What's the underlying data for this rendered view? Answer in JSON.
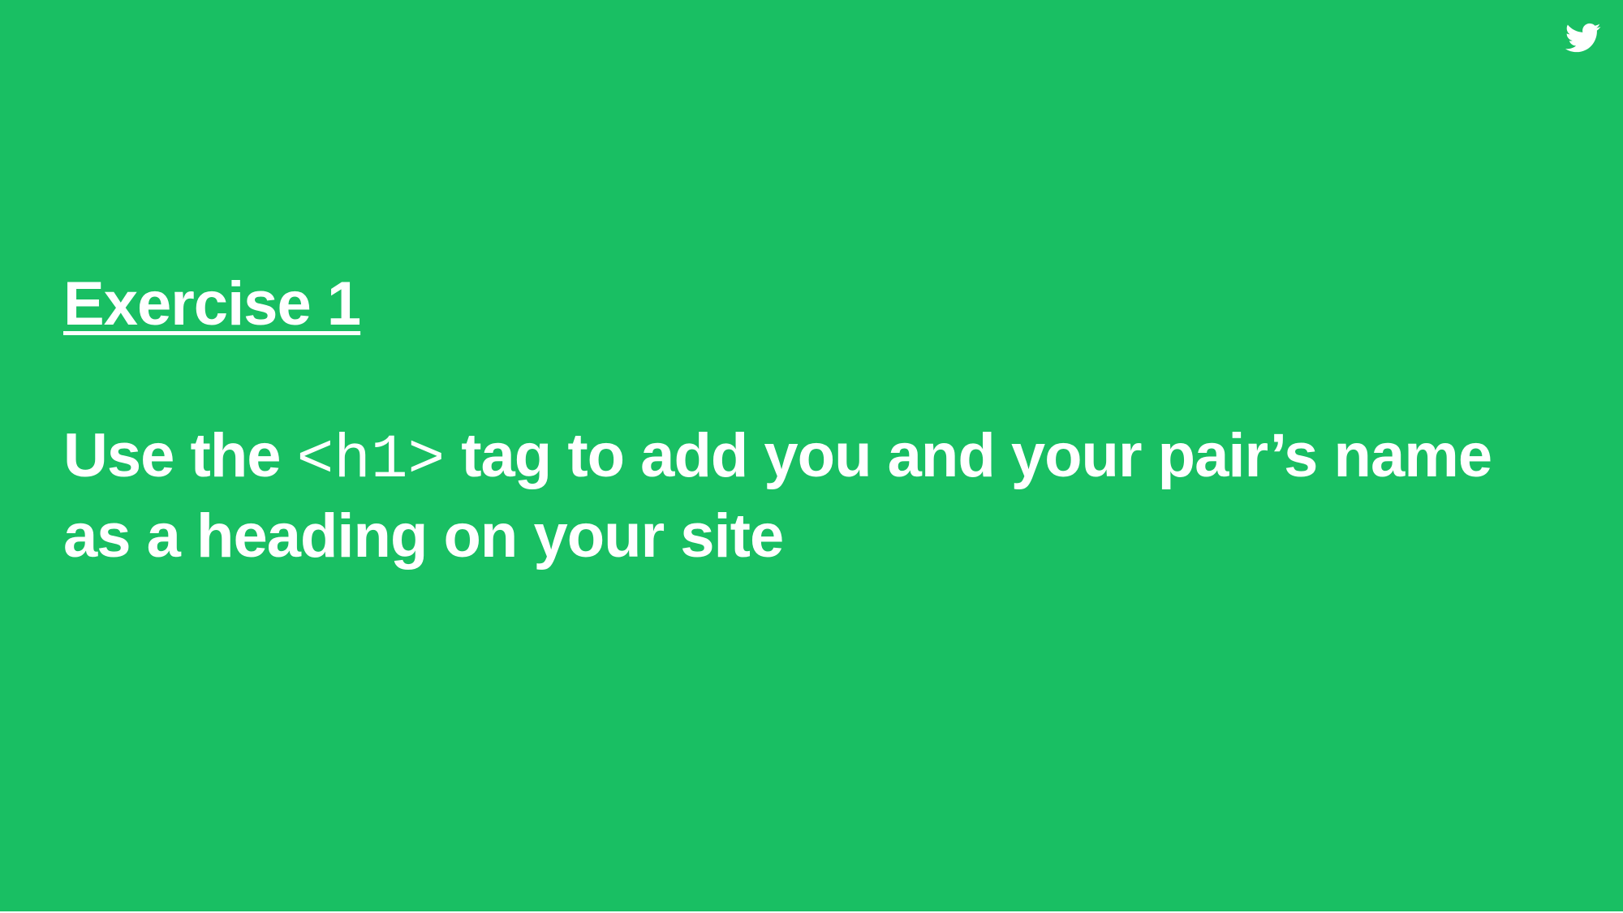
{
  "slide": {
    "title": "Exercise 1",
    "body_prefix": "Use the ",
    "code": "<h1>",
    "body_suffix": " tag to add you and your pair’s name as a heading on your site",
    "background_color": "#19bf63",
    "text_color": "#ffffff"
  },
  "icons": {
    "corner_logo": "twitter-bird-icon"
  }
}
